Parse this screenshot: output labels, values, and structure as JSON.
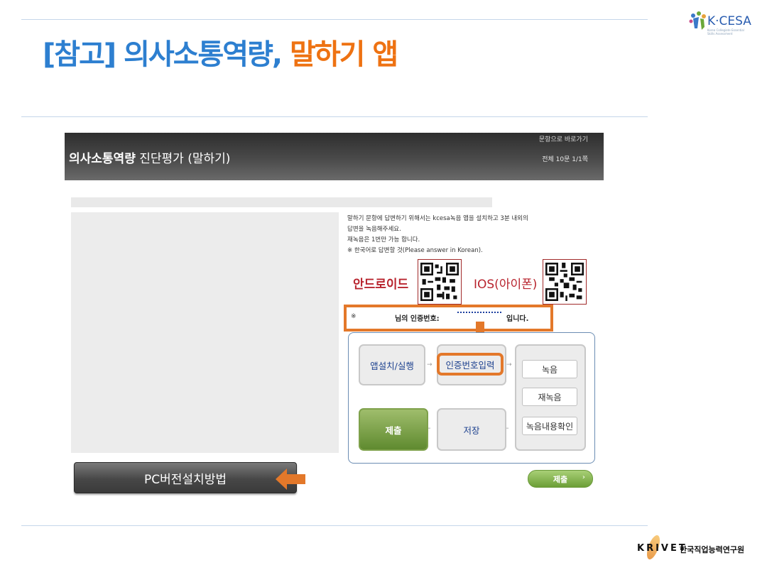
{
  "header": {
    "title_part1": "[참고] 의사소통역량,",
    "title_part2": "말하기 앱",
    "logo_text": "K·CESA",
    "logo_subtext": "Korea Collegiate Essential Skills Assessment"
  },
  "app": {
    "title_bold": "의사소통역량",
    "title_rest": "진단평가 (말하기)",
    "top_link": "문항으로 바로가기",
    "progress": "전체 10문 1/1쪽",
    "instructions": [
      "말하기 문항에 답변하기 위해서는 kcesa녹음 앱을 설치하고 3분 내외의",
      "답변을 녹음해주세요.",
      "재녹음은 1번만 가능 합니다.",
      "※ 한국어로 답변할 것(Please answer in Korean)."
    ],
    "android_label": "안드로이드",
    "ios_label": "IOS(아이폰)",
    "auth": {
      "prefix": "※",
      "middle": "님의 인증번호:",
      "suffix": "입니다."
    },
    "flow": {
      "install": "앱설치/실행",
      "auth_input": "인증번호입력",
      "record": "녹음",
      "rerecord": "재녹음",
      "confirm": "녹음내용확인",
      "save": "저장",
      "submit": "제출"
    },
    "pc_button": "PC버전설치방법",
    "submit_button": "제출",
    "submit_chevron": "›"
  },
  "footer": {
    "krivet": "KRIVET",
    "institute": "한국직업능력연구원"
  },
  "colors": {
    "title_blue": "#2d7fd0",
    "title_orange": "#ee7212",
    "highlight_orange": "#e3782a",
    "store_red": "#b8242e"
  }
}
